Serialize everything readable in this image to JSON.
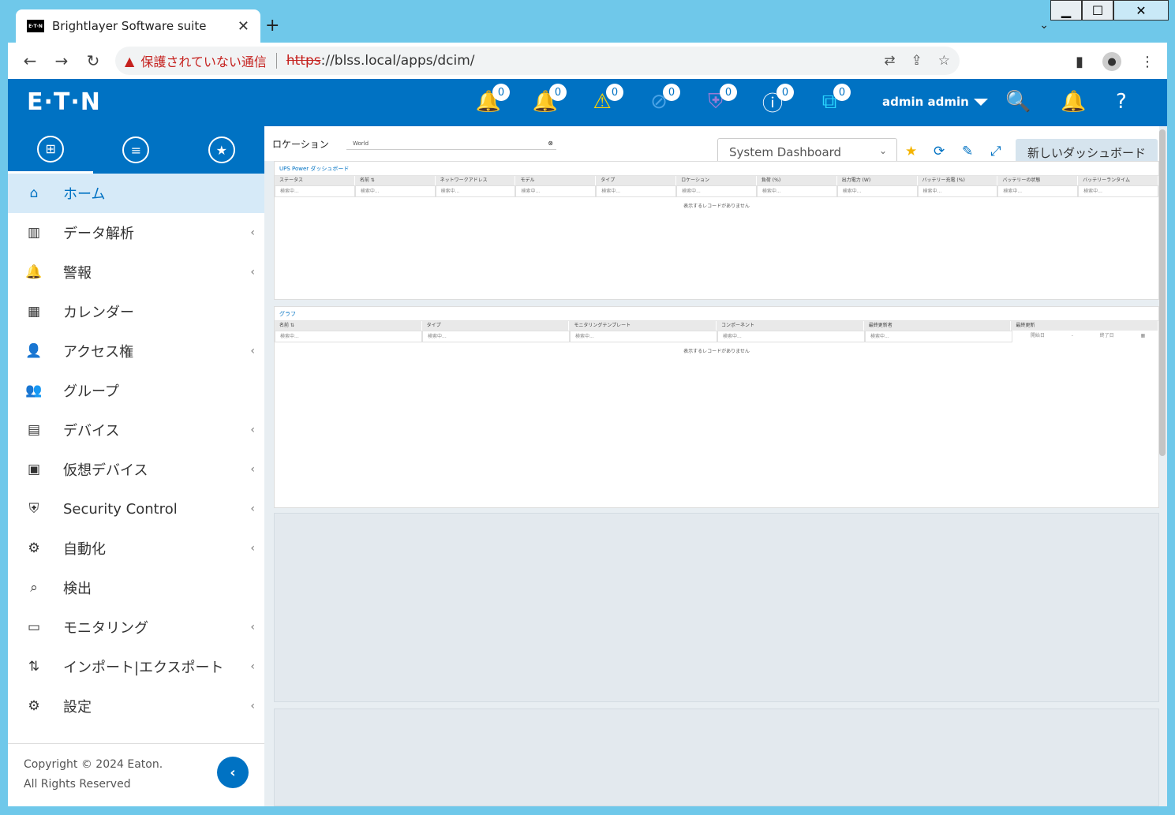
{
  "browser": {
    "tab_title": "Brightlayer Software suite",
    "tab_favicon": "E·T·N",
    "security_warning": "保護されていない通信",
    "url_scheme": "https",
    "url_rest": "://blss.local/apps/dcim/"
  },
  "header": {
    "logo": "E·T·N",
    "badges": [
      "0",
      "0",
      "0",
      "0",
      "0",
      "0",
      "0"
    ],
    "user": "admin admin"
  },
  "sidebar": {
    "items": [
      {
        "label": "ホーム",
        "icon": "home-icon",
        "chevron": false
      },
      {
        "label": "データ解析",
        "icon": "bar-chart-icon",
        "chevron": true
      },
      {
        "label": "警報",
        "icon": "alarm-icon",
        "chevron": true
      },
      {
        "label": "カレンダー",
        "icon": "calendar-icon",
        "chevron": false
      },
      {
        "label": "アクセス権",
        "icon": "user-key-icon",
        "chevron": true
      },
      {
        "label": "グループ",
        "icon": "group-icon",
        "chevron": false
      },
      {
        "label": "デバイス",
        "icon": "server-icon",
        "chevron": true
      },
      {
        "label": "仮想デバイス",
        "icon": "virtual-device-icon",
        "chevron": true
      },
      {
        "label": "Security Control",
        "icon": "shield-icon",
        "chevron": true
      },
      {
        "label": "自動化",
        "icon": "gears-icon",
        "chevron": true
      },
      {
        "label": "検出",
        "icon": "discover-icon",
        "chevron": false
      },
      {
        "label": "モニタリング",
        "icon": "monitor-icon",
        "chevron": true
      },
      {
        "label": "インポート|エクスポート",
        "icon": "import-export-icon",
        "chevron": true
      },
      {
        "label": "設定",
        "icon": "gear-icon",
        "chevron": true
      }
    ],
    "copyright": "Copyright © 2024 Eaton.",
    "rights": "All Rights Reserved"
  },
  "main": {
    "location_label": "ロケーション",
    "location_value": "World",
    "dashboard_select": "System Dashboard",
    "new_dashboard": "新しいダッシュボード",
    "ups_panel": {
      "title": "UPS Power ダッシュボード",
      "columns": [
        "ステータス",
        "名前 ⇅",
        "ネットワークアドレス",
        "モデル",
        "タイプ",
        "ロケーション",
        "負荷 (%)",
        "出力電力 (W)",
        "バッテリー充電 (%)",
        "バッテリーの状態",
        "バッテリーランタイム"
      ],
      "filters": [
        "検索中...",
        "検索中...",
        "検索中...",
        "検索中...",
        "検索中...",
        "検索中...",
        "検索中...",
        "検索中...",
        "検索中...",
        "検索中...",
        "検索中..."
      ],
      "empty": "表示するレコードがありません"
    },
    "graph_panel": {
      "title": "グラフ",
      "columns": [
        "名前 ⇅",
        "タイプ",
        "モニタリングテンプレート",
        "コンポーネント",
        "最終更新者",
        "最終更新"
      ],
      "filters": [
        "検索中...",
        "検索中...",
        "検索中...",
        "検索中...",
        "検索中..."
      ],
      "date_start": "開始日",
      "date_sep": "-",
      "date_end": "終了日",
      "empty": "表示するレコードがありません"
    }
  }
}
